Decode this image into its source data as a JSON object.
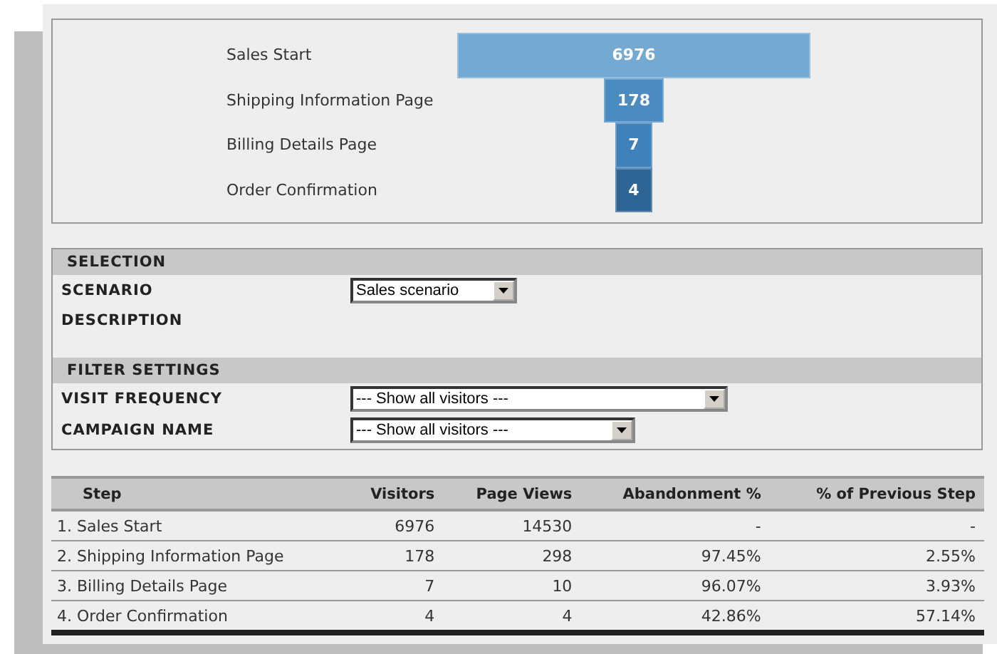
{
  "funnel": [
    {
      "label": "Sales Start",
      "value": "6976",
      "color": "#74a9d1"
    },
    {
      "label": "Shipping Information Page",
      "value": "178",
      "color": "#4a8cc2"
    },
    {
      "label": "Billing Details Page",
      "value": "7",
      "color": "#3f81bb"
    },
    {
      "label": "Order Confirmation",
      "value": "4",
      "color": "#2f6595"
    }
  ],
  "selection": {
    "title": "SELECTION",
    "fields": [
      {
        "label": "SCENARIO",
        "kind": "select",
        "value": "Sales scenario"
      },
      {
        "label": "DESCRIPTION",
        "kind": "text"
      }
    ]
  },
  "filter_settings": {
    "title": "FILTER SETTINGS",
    "fields": [
      {
        "label": "VISIT FREQUENCY",
        "kind": "select",
        "value": "--- Show all visitors ---"
      },
      {
        "label": "CAMPAIGN NAME",
        "kind": "select",
        "value": "--- Show all visitors ---"
      }
    ]
  },
  "table": {
    "columns": [
      "Step",
      "Visitors",
      "Page Views",
      "Abandonment %",
      "% of Previous Step"
    ],
    "rows": [
      [
        "1. Sales Start",
        "6976",
        "14530",
        "-",
        "-"
      ],
      [
        "2. Shipping Information Page",
        "178",
        "298",
        "97.45%",
        "2.55%"
      ],
      [
        "3. Billing Details Page",
        "7",
        "10",
        "96.07%",
        "3.93%"
      ],
      [
        "4. Order Confirmation",
        "4",
        "4",
        "42.86%",
        "57.14%"
      ]
    ]
  }
}
